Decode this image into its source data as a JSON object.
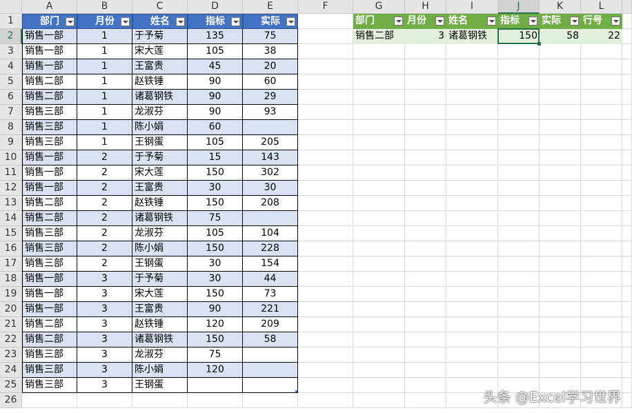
{
  "columns": [
    "A",
    "B",
    "C",
    "D",
    "E",
    "F",
    "G",
    "H",
    "I",
    "J",
    "K",
    "L"
  ],
  "selected_cell": {
    "col": "J",
    "row": 2
  },
  "table1": {
    "headers": [
      "部门",
      "月份",
      "姓名",
      "指标",
      "实际"
    ],
    "rows": [
      [
        "销售一部",
        "1",
        "于予菊",
        "135",
        "75"
      ],
      [
        "销售一部",
        "1",
        "宋大莲",
        "105",
        "38"
      ],
      [
        "销售一部",
        "1",
        "王富贵",
        "45",
        "20"
      ],
      [
        "销售二部",
        "1",
        "赵铁锤",
        "90",
        "60"
      ],
      [
        "销售二部",
        "1",
        "诸葛钢铁",
        "90",
        "29"
      ],
      [
        "销售三部",
        "1",
        "龙淑芬",
        "90",
        "93"
      ],
      [
        "销售三部",
        "1",
        "陈小娟",
        "60",
        ""
      ],
      [
        "销售三部",
        "1",
        "王钢蛋",
        "105",
        "205"
      ],
      [
        "销售一部",
        "2",
        "于予菊",
        "15",
        "143"
      ],
      [
        "销售一部",
        "2",
        "宋大莲",
        "150",
        "302"
      ],
      [
        "销售一部",
        "2",
        "王富贵",
        "30",
        "30"
      ],
      [
        "销售二部",
        "2",
        "赵铁锤",
        "150",
        "208"
      ],
      [
        "销售二部",
        "2",
        "诸葛钢铁",
        "75",
        ""
      ],
      [
        "销售三部",
        "2",
        "龙淑芬",
        "105",
        "104"
      ],
      [
        "销售三部",
        "2",
        "陈小娟",
        "150",
        "228"
      ],
      [
        "销售三部",
        "2",
        "王钢蛋",
        "30",
        "154"
      ],
      [
        "销售一部",
        "3",
        "于予菊",
        "30",
        "44"
      ],
      [
        "销售一部",
        "3",
        "宋大莲",
        "150",
        "73"
      ],
      [
        "销售一部",
        "3",
        "王富贵",
        "90",
        "221"
      ],
      [
        "销售二部",
        "3",
        "赵铁锤",
        "120",
        "209"
      ],
      [
        "销售二部",
        "3",
        "诸葛钢铁",
        "150",
        "58"
      ],
      [
        "销售三部",
        "3",
        "龙淑芬",
        "75",
        ""
      ],
      [
        "销售三部",
        "3",
        "陈小娟",
        "120",
        ""
      ],
      [
        "销售三部",
        "3",
        "王钢蛋",
        "",
        ""
      ]
    ]
  },
  "table2": {
    "headers": [
      "部门",
      "月份",
      "姓名",
      "指标",
      "实际",
      "行号"
    ],
    "rows": [
      [
        "销售二部",
        "3",
        "诸葛钢铁",
        "150",
        "58",
        "22"
      ]
    ]
  },
  "watermark": "头条 @Excel学习世界",
  "colors": {
    "table1_header": "#4472c4",
    "table1_band": "#d9e1f2",
    "table2_header": "#70ad47",
    "table2_band": "#e2efda",
    "selection": "#217346"
  }
}
